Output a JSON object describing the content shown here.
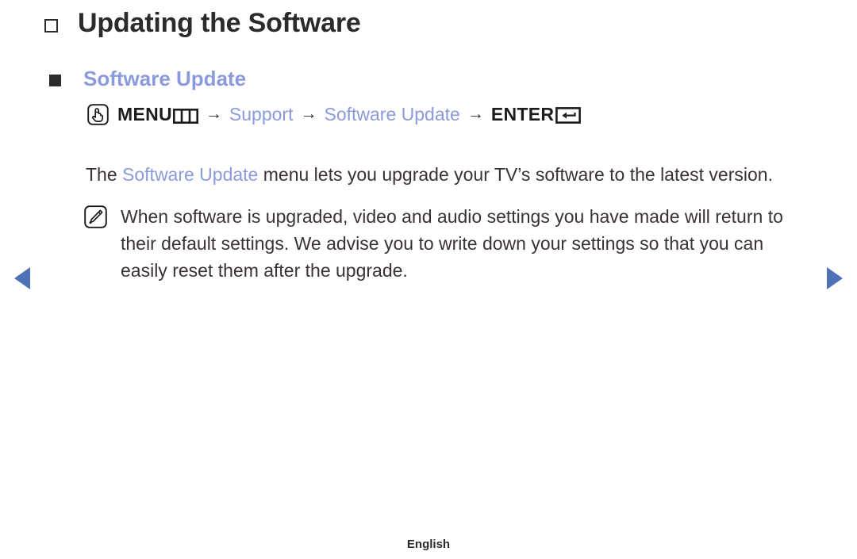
{
  "page": {
    "title": "Updating the Software",
    "footer_language": "English"
  },
  "section": {
    "heading": "Software Update"
  },
  "menu_path": {
    "oo_icon": "oo-hand-press-icon",
    "menu_label": "MENU",
    "menu_grid_icon": "menu-grid-icon",
    "separator": "→",
    "step_support": "Support",
    "step_software_update": "Software Update",
    "enter_label": "ENTER",
    "enter_icon": "enter-return-icon"
  },
  "body": {
    "text_before": "The ",
    "highlight": "Software Update",
    "text_after": " menu lets you upgrade your TV’s software to the latest version."
  },
  "note": {
    "icon": "note-pencil-icon",
    "text": "When software is upgraded, video and audio settings you have made will return to their default settings. We advise you to write down your settings so that you can easily reset them after the upgrade."
  },
  "navigation": {
    "prev_icon": "previous-page-arrow-icon",
    "next_icon": "next-page-arrow-icon"
  },
  "colors": {
    "accent_blue": "#8b9adc",
    "nav_arrow_blue": "#4f71b8",
    "text_dark": "#2b2b2b",
    "body_text": "#3a3234"
  }
}
